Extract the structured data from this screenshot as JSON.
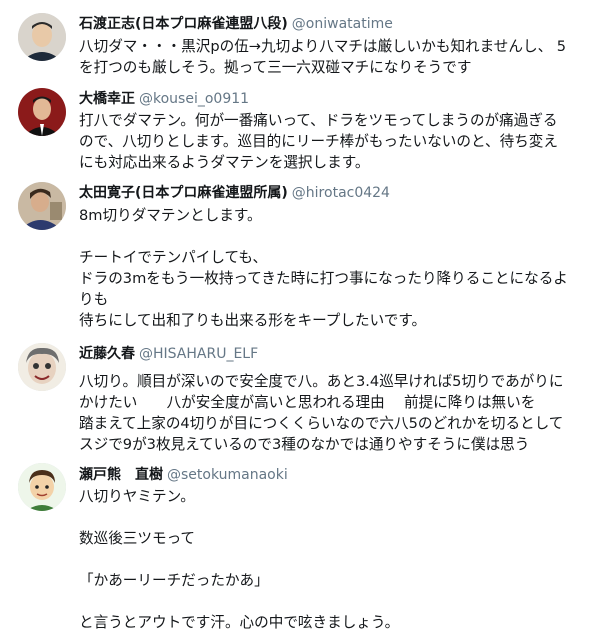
{
  "tweets": [
    {
      "name": "石渡正志(日本プロ麻雀連盟八段)",
      "handle": "@oniwatatime",
      "avatar_icon": "user-avatar-icon",
      "lines": [
        "八切ダマ・・・黒沢pの伍→九切より八マチは厳しいかも知れませんし、 5",
        "を打つのも厳しそう。拠って三一六双碰マチになりそうです"
      ]
    },
    {
      "name": "大橋幸正",
      "handle": "@kousei_o0911",
      "avatar_icon": "user-avatar-icon",
      "lines": [
        "打八でダマテン。何が一番痛いって、ドラをツモってしまうのが痛過ぎる",
        "ので、八切りとします。巡目的にリーチ棒がもったいないのと、待ち変え",
        "にも対応出来るようダマテンを選択します。"
      ]
    },
    {
      "name": "太田寛子(日本プロ麻雀連盟所属)",
      "handle": "@hirotac0424",
      "avatar_icon": "user-avatar-icon",
      "lines": [
        "8m切りダマテンとします。",
        "",
        "チートイでテンパイしても、",
        "ドラの3mをもう一枚持ってきた時に打つ事になったり降りることになるよ",
        "りも",
        "待ちにして出和了りも出来る形をキープしたいです。"
      ]
    },
    {
      "name": "近藤久春",
      "handle": "@HISAHARU_ELF",
      "avatar_icon": "user-avatar-icon",
      "lines": [
        "八切り。順目が深いので安全度で八。あと3.4巡早ければ5切りであがりに",
        "かけたい　　八が安全度が高いと思われる理由　 前提に降りは無いを",
        "踏まえて上家の4切りが目につくくらいなので六八5のどれかを切るとして",
        "スジで9が3枚見えているので3種のなかでは通りやすそうに僕は思う"
      ]
    },
    {
      "name": "瀬戸熊　直樹",
      "handle": "@setokumanaoki",
      "avatar_icon": "user-avatar-icon",
      "lines": [
        "八切りヤミテン。",
        "",
        "数巡後三ツモって",
        "",
        "「かあーリーチだったかあ」",
        "",
        "と言うとアウトです汗。心の中で呟きましょう。"
      ]
    }
  ],
  "colors": {
    "name": "#14171a",
    "handle": "#657786",
    "text": "#14171a",
    "background": "#ffffff"
  }
}
